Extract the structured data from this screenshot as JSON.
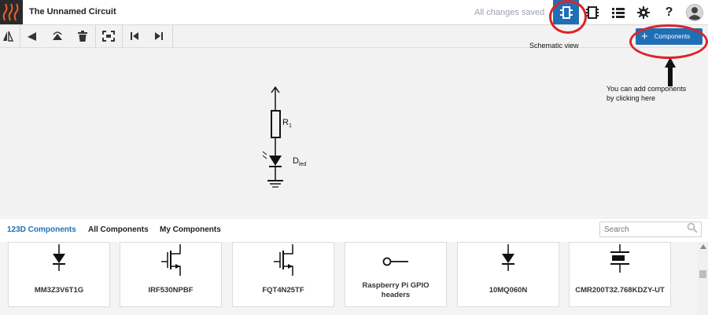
{
  "header": {
    "title": "The Unnamed Circuit",
    "save_status": "All changes saved",
    "buttons": [
      {
        "icon": "schematic-view-icon",
        "active": true
      },
      {
        "icon": "breadboard-view-icon"
      },
      {
        "icon": "list-view-icon"
      },
      {
        "icon": "gear-icon"
      },
      {
        "icon": "help-icon"
      },
      {
        "icon": "user-avatar-icon"
      }
    ]
  },
  "toolbar": {
    "tools": [
      "flip-horizontal-icon",
      "rotate-left-icon",
      "rotate-right-icon",
      "trash-icon",
      "fit-view-icon",
      "step-back-icon",
      "step-forward-icon"
    ]
  },
  "annotations": {
    "schematic_view": "Schematic view",
    "add_components_line1": "You can add components",
    "add_components_line2": "by clicking here"
  },
  "add_button": {
    "label": "Components"
  },
  "schematic": {
    "resistor_label": "R",
    "resistor_sub": "1",
    "led_label": "D",
    "led_sub": "led"
  },
  "library": {
    "tabs": [
      "123D Components",
      "All Components",
      "My Components"
    ],
    "active_tab": "123D Components",
    "search_placeholder": "Search",
    "components": [
      {
        "name": "MM3Z3V6T1G",
        "symbol": "diode-icon"
      },
      {
        "name": "IRF530NPBF",
        "symbol": "mosfet-icon"
      },
      {
        "name": "FQT4N25TF",
        "symbol": "mosfet-icon"
      },
      {
        "name": "Raspberry Pi GPIO headers",
        "symbol": "header-pin-icon"
      },
      {
        "name": "10MQ060N",
        "symbol": "diode-icon"
      },
      {
        "name": "CMR200T32.768KDZY-UT",
        "symbol": "crystal-icon"
      }
    ]
  },
  "colors": {
    "accent": "#1f6fb5",
    "highlight": "#d9252a",
    "canvas": "#f2f2f2"
  }
}
